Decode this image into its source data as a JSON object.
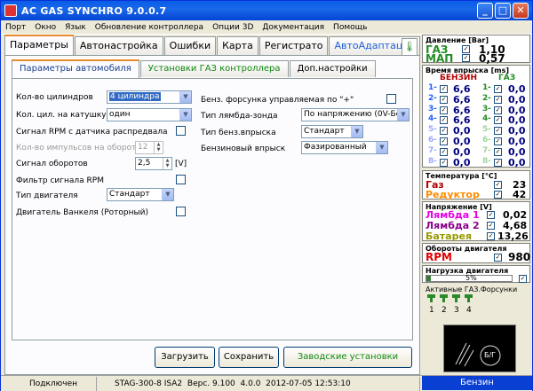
{
  "window": {
    "title": "AC GAS SYNCHRO  9.0.0.7"
  },
  "menu": [
    "Порт",
    "Окно",
    "Язык",
    "Обновление контроллера",
    "Опции 3D",
    "Документация",
    "Помощь"
  ],
  "main_tabs": [
    "Параметры",
    "Автонастройка",
    "Ошибки",
    "Карта",
    "Регистрато",
    "АвтоАдаптация"
  ],
  "sub_tabs": [
    "Параметры автомобиля",
    "Установки ГАЗ контроллера",
    "Доп.настройки"
  ],
  "form": {
    "cylinders_label": "Кол-во цилиндров",
    "cylinders_value": "4 цилиндра",
    "cyl_per_coil_label": "Кол. цил. на катушку",
    "cyl_per_coil_value": "один",
    "rpm_signal_label": "Сигнал RPM с датчика распредвала",
    "pulses_label": "Кол-во импульсов на оборот",
    "pulses_value": "12",
    "rpm_signal_volt_label": "Сигнал оборотов",
    "rpm_signal_volt_value": "2,5",
    "rpm_signal_volt_unit": "[V]",
    "rpm_filter_label": "Фильтр сигнала RPM",
    "engine_type_label": "Тип двигателя",
    "engine_type_value": "Стандарт",
    "wankel_label": "Двигатель Ванкеля (Роторный)",
    "petrol_injector_label": "Бенз. форсунка управляемая по \"+\"",
    "lambda_type_label": "Тип лямбда-зонда",
    "lambda_type_value": "По напряжению  (0V-Бе",
    "petrol_injection_type_label": "Тип бенз.впрыска",
    "petrol_injection_type_value": "Стандарт",
    "petrol_injection_label": "Бензиновый впрыск",
    "petrol_injection_value": "Фазированный"
  },
  "buttons": {
    "load": "Загрузить",
    "save": "Сохранить",
    "factory": "Заводские установки"
  },
  "status": {
    "connection": "Подключен",
    "device": "STAG-300-8 ISA2",
    "version_label": "Верс.",
    "version": "9.100",
    "fw": "4.0.0",
    "datetime": "2012-07-05 12:53:10",
    "mode": "Бензин"
  },
  "pressure": {
    "header": "Давление [Bar]",
    "gas_label": "ГАЗ",
    "gas_value": "1,10",
    "map_label": "МАП",
    "map_value": "0,57"
  },
  "injection": {
    "header": "Время впрыска [ms]",
    "petrol_label": "БЕНЗИН",
    "gas_label": "ГАЗ",
    "rows": [
      {
        "n": "1",
        "petrol": "6,6",
        "gas": "0,0"
      },
      {
        "n": "2",
        "petrol": "6,6",
        "gas": "0,0"
      },
      {
        "n": "3",
        "petrol": "6,6",
        "gas": "0,0"
      },
      {
        "n": "4",
        "petrol": "6,6",
        "gas": "0,0"
      },
      {
        "n": "5",
        "petrol": "0,0",
        "gas": "0,0"
      },
      {
        "n": "6",
        "petrol": "0,0",
        "gas": "0,0"
      },
      {
        "n": "7",
        "petrol": "0,0",
        "gas": "0,0"
      },
      {
        "n": "8",
        "petrol": "0,0",
        "gas": "0,0"
      }
    ]
  },
  "temperature": {
    "header": "Температура  [°C]",
    "gas_label": "Газ",
    "gas_value": "23",
    "reducer_label": "Редуктор",
    "reducer_value": "42"
  },
  "voltage": {
    "header": "Напряжение [V]",
    "lambda1_label": "Лямбда 1",
    "lambda1_value": "0,02",
    "lambda2_label": "Лямбда 2",
    "lambda2_value": "4,68",
    "battery_label": "Батарея",
    "battery_value": "13,26"
  },
  "rpm": {
    "header": "Обороты двигателя",
    "label": "RPM",
    "value": "980"
  },
  "load": {
    "header": "Нагрузка двигателя",
    "value": "5%",
    "fraction": 0.05
  },
  "active_injectors": {
    "header": "Активные ГАЗ.Форсунки",
    "numbers": [
      "1",
      "2",
      "3",
      "4"
    ]
  },
  "switch": {
    "label": "Б/Г"
  }
}
